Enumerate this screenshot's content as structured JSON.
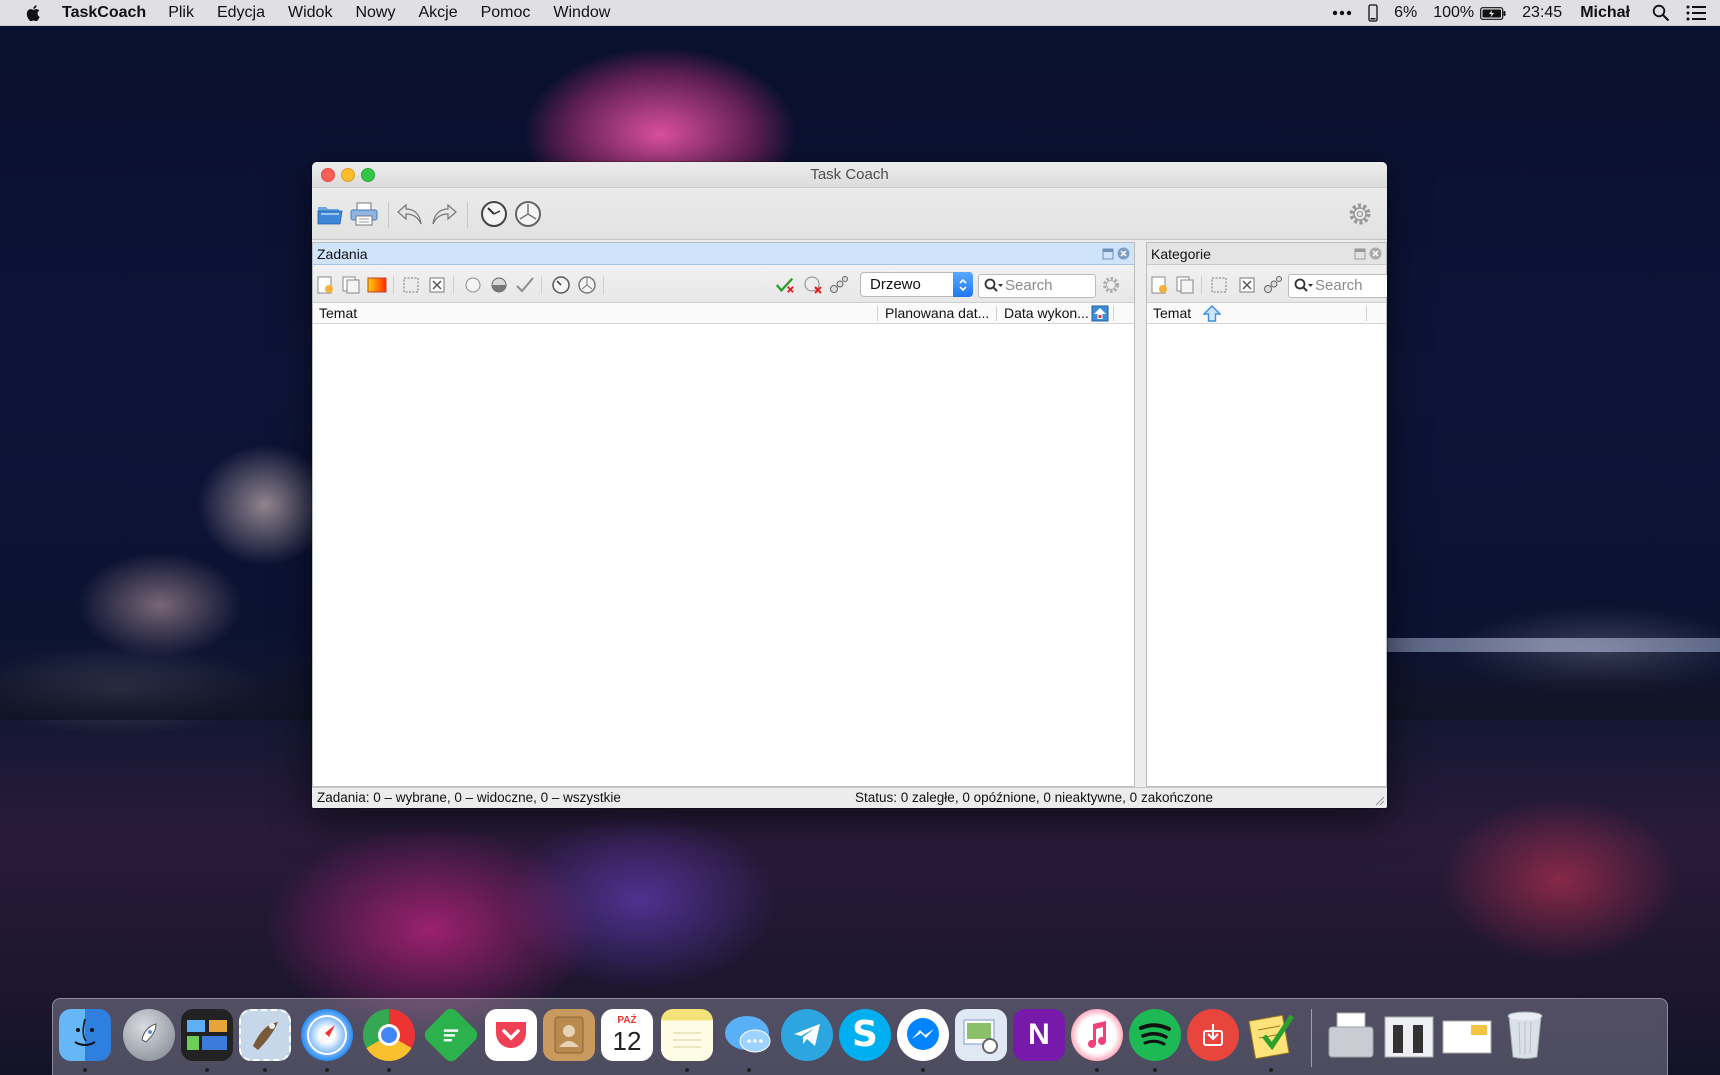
{
  "menubar": {
    "app_name": "TaskCoach",
    "items": [
      "Plik",
      "Edycja",
      "Widok",
      "Nowy",
      "Akcje",
      "Pomoc",
      "Window"
    ],
    "battery_small": "6%",
    "battery_main": "100%",
    "clock": "23:45",
    "user": "Michał"
  },
  "window": {
    "title": "Task Coach"
  },
  "tasks_pane": {
    "title": "Zadania",
    "view_mode": "Drzewo",
    "search_placeholder": "Search",
    "columns": [
      "Temat",
      "Planowana dat...",
      "Data wykon..."
    ]
  },
  "categories_pane": {
    "title": "Kategorie",
    "search_placeholder": "Search",
    "columns": [
      "Temat"
    ]
  },
  "statusbar": {
    "left": "Zadania: 0 – wybrane, 0 – widoczne, 0 – wszystkie",
    "right": "Status: 0 zaległe, 0 opóźnione, 0 nieaktywne, 0 zakończone"
  },
  "colors": {
    "pane_header_active": "#cfe3fb",
    "select_accent": "#1f78f0"
  },
  "icons": {
    "menubar": [
      "apple-icon",
      "more-icon",
      "phone-battery-icon",
      "battery-icon",
      "spotlight-icon",
      "notification-center-icon"
    ],
    "dock": [
      "finder-icon",
      "launchpad-icon",
      "mission-control-icon",
      "mail-stamp-icon",
      "safari-icon",
      "chrome-icon",
      "feedly-icon",
      "pocket-icon",
      "contacts-icon",
      "calendar-icon",
      "notes-icon",
      "messages-icon",
      "telegram-icon",
      "skype-icon",
      "messenger-icon",
      "preview-icon",
      "onenote-icon",
      "itunes-icon",
      "spotify-icon",
      "transmit-icon",
      "taskcoach-icon",
      "downloads-stack-icon",
      "documents-stack-icon",
      "files-stack-icon",
      "trash-icon"
    ]
  },
  "dock": {
    "calendar_month": "PAŹ",
    "calendar_day": "12"
  }
}
